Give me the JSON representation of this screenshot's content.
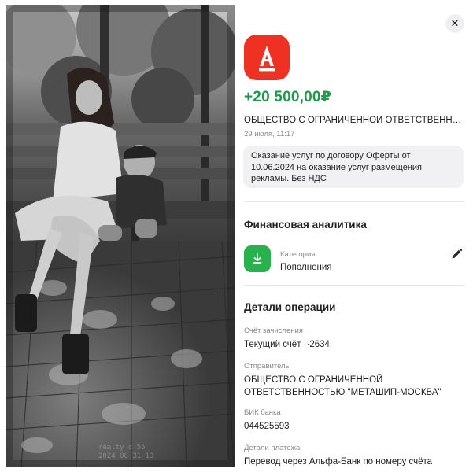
{
  "photo": {
    "caption_line1": "realty c 55",
    "caption_line2": "2024 08 31 13"
  },
  "header": {
    "close_symbol": "✕"
  },
  "transaction": {
    "bank_logo_letter": "A",
    "amount": "+20 500,00₽",
    "sender_short": "ОБЩЕСТВО С ОГРАНИЧЕННОЙ ОТВЕТСТВЕННО...",
    "datetime": "29 июля, 11:17",
    "purpose_line1": "Оказание услуг по договору Оферты от",
    "purpose_line2": "10.06.2024 на оказание услуг размещения",
    "purpose_line3": "рекламы. Без НДС",
    "amount_color": "#1e9a4a",
    "brand_color": "#ef3124"
  },
  "analytics": {
    "title": "Финансовая аналитика",
    "category_label": "Категория",
    "category_value": "Пополнения",
    "category_icon": "download-arrow-icon",
    "category_color": "#28b14c"
  },
  "details": {
    "title": "Детали операции",
    "account_label": "Счёт зачисления",
    "account_value": "Текущий счёт ··2634",
    "sender_label": "Отправитель",
    "sender_line1": "ОБЩЕСТВО С ОГРАНИЧЕННОЙ",
    "sender_line2": "ОТВЕТСТВЕННОСТЬЮ \"МЕТАШИП-МОСКВА\"",
    "bik_label": "БИК банка",
    "bik_value": "044525593",
    "payment_label": "Детали платежа",
    "payment_value": "Перевод через Альфа-Банк по номеру счёта"
  }
}
